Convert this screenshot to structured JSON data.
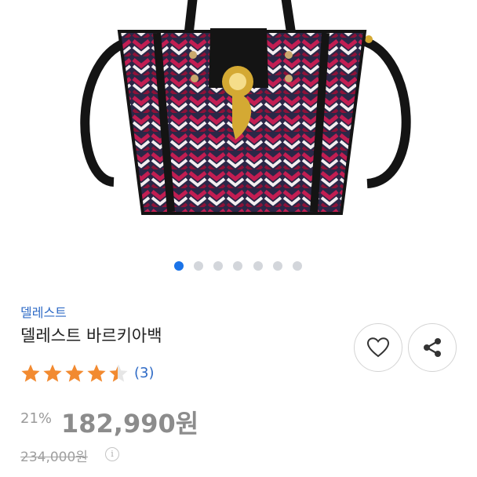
{
  "product": {
    "brand": "델레스트",
    "name": "델레스트 바르키아백",
    "rating": 4.5,
    "rating_count": "(3)",
    "discount": "21%",
    "price": "182,990원",
    "original_price": "234,000원"
  },
  "carousel": {
    "total": 7,
    "active_index": 0
  },
  "colors": {
    "accent": "#1a73e8",
    "brand_link": "#2f6bc6",
    "star": "#f28a30",
    "bag_red": "#b2164a",
    "bag_navy": "#1f2340",
    "bag_leather": "#141414",
    "hardware_gold": "#d4a933"
  },
  "icons": {
    "wishlist": "heart-icon",
    "share": "share-icon",
    "info": "info-icon",
    "rating": "star-icon"
  }
}
